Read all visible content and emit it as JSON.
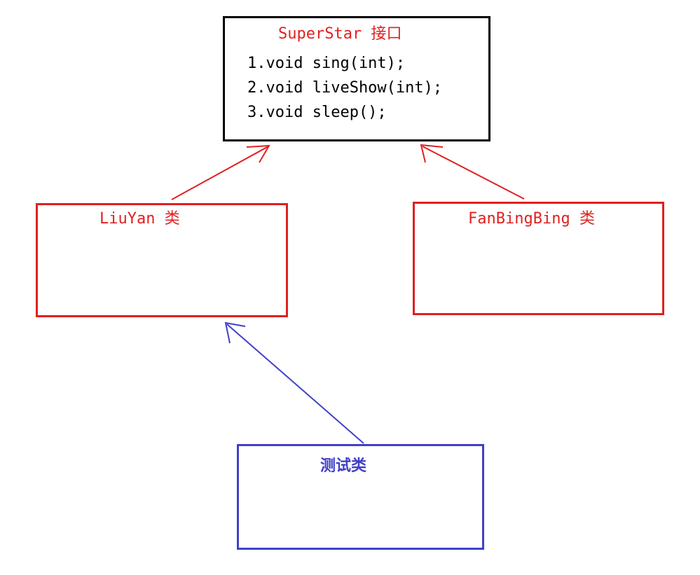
{
  "interface": {
    "title": "SuperStar 接口",
    "methods": [
      "1.void sing(int);",
      "2.void liveShow(int);",
      "3.void sleep();"
    ]
  },
  "class_liuyan": {
    "title": "LiuYan 类"
  },
  "class_fanbingbing": {
    "title": "FanBingBing 类"
  },
  "class_test": {
    "title": "测试类"
  },
  "colors": {
    "interface_border": "#000000",
    "class_border": "#e02020",
    "class_title": "#e02020",
    "test_border": "#4040c8",
    "test_title": "#4040c8",
    "implements_arrow": "#e02020",
    "uses_arrow": "#4040c8"
  },
  "relations": [
    {
      "from": "LiuYan 类",
      "to": "SuperStar 接口",
      "color": "#e02020"
    },
    {
      "from": "FanBingBing 类",
      "to": "SuperStar 接口",
      "color": "#e02020"
    },
    {
      "from": "测试类",
      "to": "LiuYan 类",
      "color": "#4040c8"
    }
  ]
}
